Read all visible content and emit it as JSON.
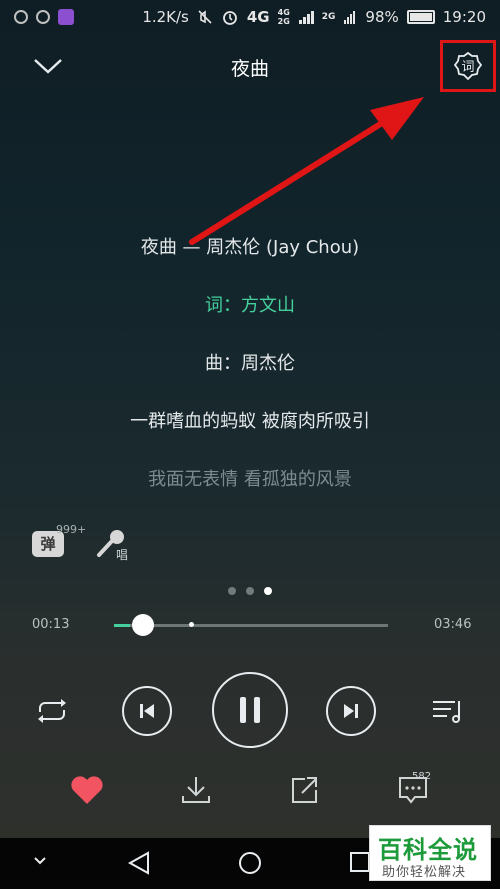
{
  "status_bar": {
    "speed": "1.2K/s",
    "network_1": "4G",
    "network_2a": "4G",
    "network_2b": "2G",
    "network_3": "2G",
    "battery": "98%",
    "time": "19:20"
  },
  "header": {
    "title": "夜曲",
    "lyric_setting_label": "词"
  },
  "lyrics": [
    "夜曲 — 周杰伦 (Jay Chou)",
    "词：方文山",
    "曲：周杰伦",
    "一群嗜血的蚂蚁 被腐肉所吸引",
    "我面无表情 看孤独的风景"
  ],
  "side": {
    "danmu_label": "弹",
    "danmu_count": "999+",
    "sing_label": "唱"
  },
  "player": {
    "current_time": "00:13",
    "total_time": "03:46",
    "progress": 0.0575,
    "buffered": 0.28
  },
  "actions": {
    "comment_count": "582"
  },
  "watermark": {
    "main": "百科全说",
    "sub": "助你轻松解决"
  },
  "colors": {
    "accent": "#45d19d",
    "like": "#f25461",
    "highlight_box": "#e01515",
    "arrow": "#e01515"
  }
}
